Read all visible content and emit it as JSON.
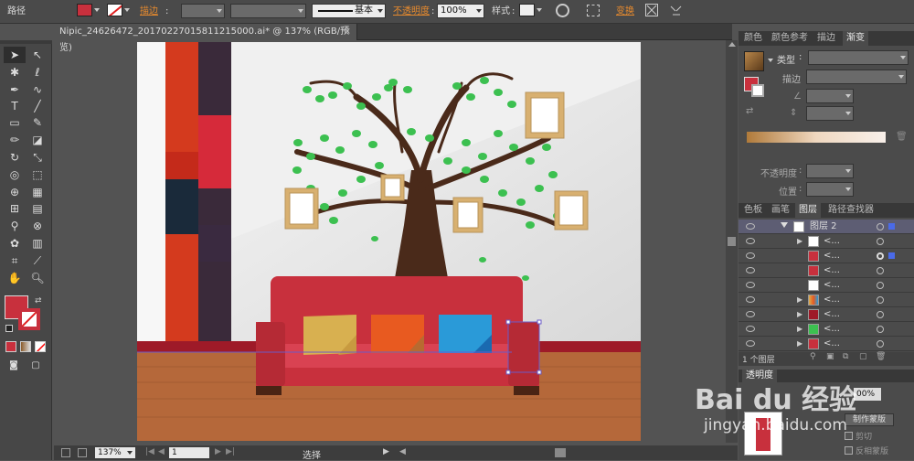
{
  "control_bar": {
    "selection_label": "路径",
    "stroke_label": "描边",
    "stroke_style": "基本",
    "opacity_label": "不透明度",
    "opacity_value": "100%",
    "style_label": "样式",
    "transform_label": "变换"
  },
  "document": {
    "tab_title": "Nipic_24626472_20170227015811215000.ai* @ 137% (RGB/预览)",
    "close": "×"
  },
  "status_bar": {
    "zoom": "137%",
    "page": "1",
    "status": "选择"
  },
  "gradient_panel": {
    "tabs": [
      "颜色",
      "颜色参考",
      "描边",
      "渐变"
    ],
    "active_tab": 3,
    "type_label": "类型",
    "stroke_label": "描边",
    "opacity_label": "不透明度",
    "position_label": "位置"
  },
  "layers_panel": {
    "tabs": [
      "色板",
      "画笔",
      "图层",
      "路径查找器"
    ],
    "active_tab": 2,
    "layer_name": "图层 2",
    "sublayers": [
      "<...",
      "<...",
      "<...",
      "<...",
      "<...",
      "<...",
      "<...",
      "<..."
    ],
    "count_label": "1 个图层"
  },
  "transparency_panel": {
    "title": "透明度",
    "opacity_value": "00%",
    "mask_button": "制作蒙版",
    "clip_label": "剪切",
    "invert_label": "反相蒙版"
  },
  "watermark": {
    "brand": "Bai du 经验",
    "url": "jingyan.baidu.com"
  },
  "colors": {
    "sofa": "#c8303d",
    "floor": "#b5683a",
    "accent": "#e68a2e"
  }
}
